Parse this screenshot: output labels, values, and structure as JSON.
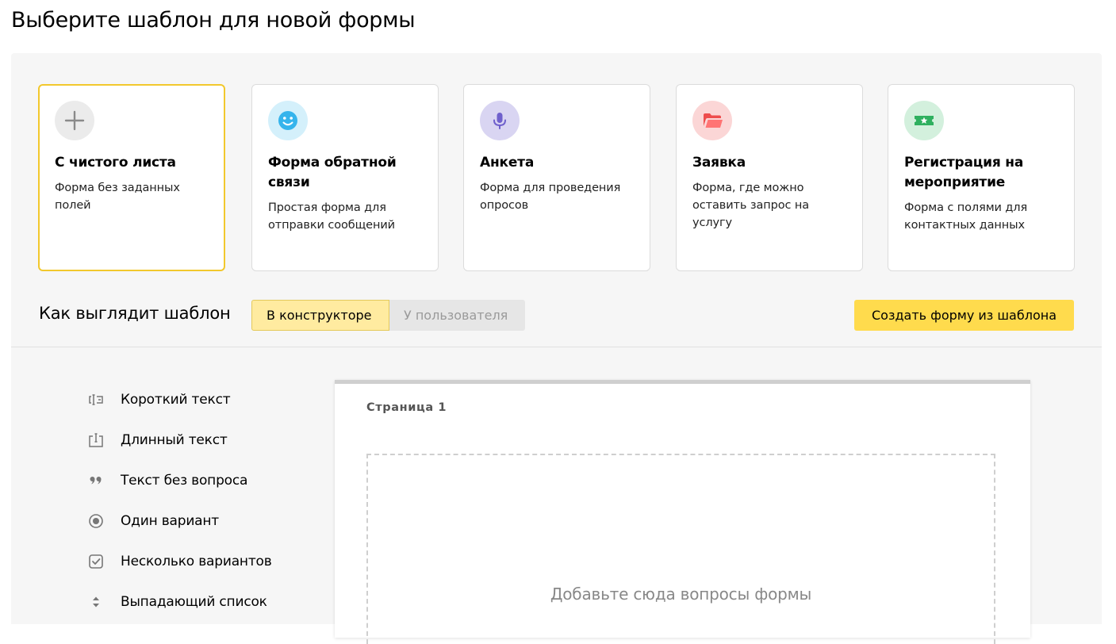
{
  "header": {
    "title": "Выберите шаблон для новой формы"
  },
  "templates": [
    {
      "title": "С чистого листа",
      "desc": "Форма без заданных полей",
      "icon": "plus-icon",
      "icon_bg": "#ebebeb",
      "selected": true
    },
    {
      "title": "Форма обратной связи",
      "desc": "Простая форма для отправки сообщений",
      "icon": "smile-icon",
      "icon_bg": "#d4f0fb"
    },
    {
      "title": "Анкета",
      "desc": "Форма для проведения опросов",
      "icon": "microphone-icon",
      "icon_bg": "#d9d5f2"
    },
    {
      "title": "Заявка",
      "desc": "Форма, где можно оставить запрос на услугу",
      "icon": "folder-icon",
      "icon_bg": "#fbd6d6"
    },
    {
      "title": "Регистрация на мероприятие",
      "desc": "Форма с полями для контактных данных",
      "icon": "ticket-icon",
      "icon_bg": "#d3f0dd"
    }
  ],
  "preview": {
    "label": "Как выглядит шаблон",
    "tabs": [
      {
        "label": "В конструкторе",
        "active": true
      },
      {
        "label": "У пользователя",
        "active": false
      }
    ],
    "create_button": "Создать форму из шаблона"
  },
  "field_types": [
    {
      "label": "Короткий текст",
      "icon": "short-text-icon"
    },
    {
      "label": "Длинный текст",
      "icon": "long-text-icon"
    },
    {
      "label": "Текст без вопроса",
      "icon": "quote-icon"
    },
    {
      "label": "Один вариант",
      "icon": "radio-icon"
    },
    {
      "label": "Несколько вариантов",
      "icon": "checkbox-icon"
    },
    {
      "label": "Выпадающий список",
      "icon": "dropdown-arrows-icon"
    }
  ],
  "canvas": {
    "page_label": "Страница 1",
    "drop_hint": "Добавьте сюда вопросы формы"
  },
  "colors": {
    "accent_yellow": "#ffdb4d",
    "selected_border": "#f2c82d",
    "segment_active": "#ffeba0",
    "panel_bg": "#f6f6f6"
  }
}
